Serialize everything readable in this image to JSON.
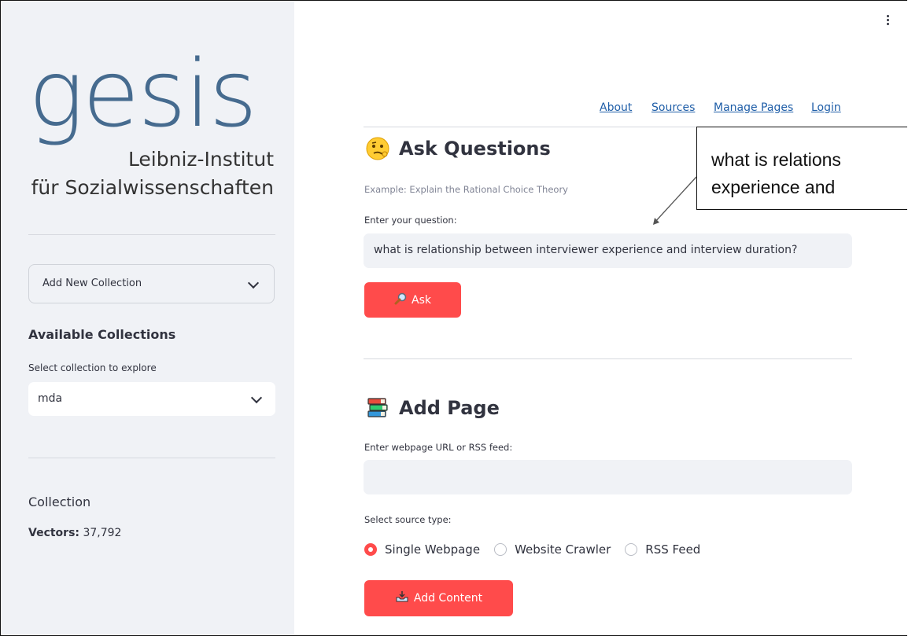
{
  "sidebar": {
    "logo": {
      "word": "gesis",
      "line1": "Leibniz-Institut",
      "line2": "für Sozialwissenschaften"
    },
    "add_collection": {
      "label": "Add New Collection",
      "icon": "chevron-down-icon"
    },
    "available_collections": {
      "heading": "Available Collections",
      "select_label": "Select collection to explore",
      "selected": "mda"
    },
    "collection": {
      "heading": "Collection",
      "vectors_label": "Vectors:",
      "vectors_value": "37,792"
    }
  },
  "header": {
    "menu_icon": "more-vertical-icon",
    "nav": [
      "About",
      "Sources",
      "Manage Pages",
      "Login"
    ]
  },
  "ask_section": {
    "emoji": "confused-face-icon",
    "title": "Ask Questions",
    "example": "Example: Explain the Rational Choice Theory",
    "input_label": "Enter your question:",
    "input_value": "what is relationship between interviewer experience and interview duration?",
    "button_label": "Ask",
    "button_icon": "magnifier-icon"
  },
  "add_page_section": {
    "emoji": "books-icon",
    "title": "Add Page",
    "input_label": "Enter webpage URL or RSS feed:",
    "input_value": "",
    "source_type_label": "Select source type:",
    "source_options": [
      "Single Webpage",
      "Website Crawler",
      "RSS Feed"
    ],
    "selected_option": "Single Webpage",
    "button_label": "Add Content",
    "button_icon": "inbox-tray-icon"
  },
  "callout": {
    "line1": "what is relations",
    "line2": "experience and"
  },
  "colors": {
    "accent": "#ff4b4b",
    "sidebar_bg": "#f0f2f6",
    "logo_blue": "#466b8f",
    "link": "#1f5ea8"
  }
}
